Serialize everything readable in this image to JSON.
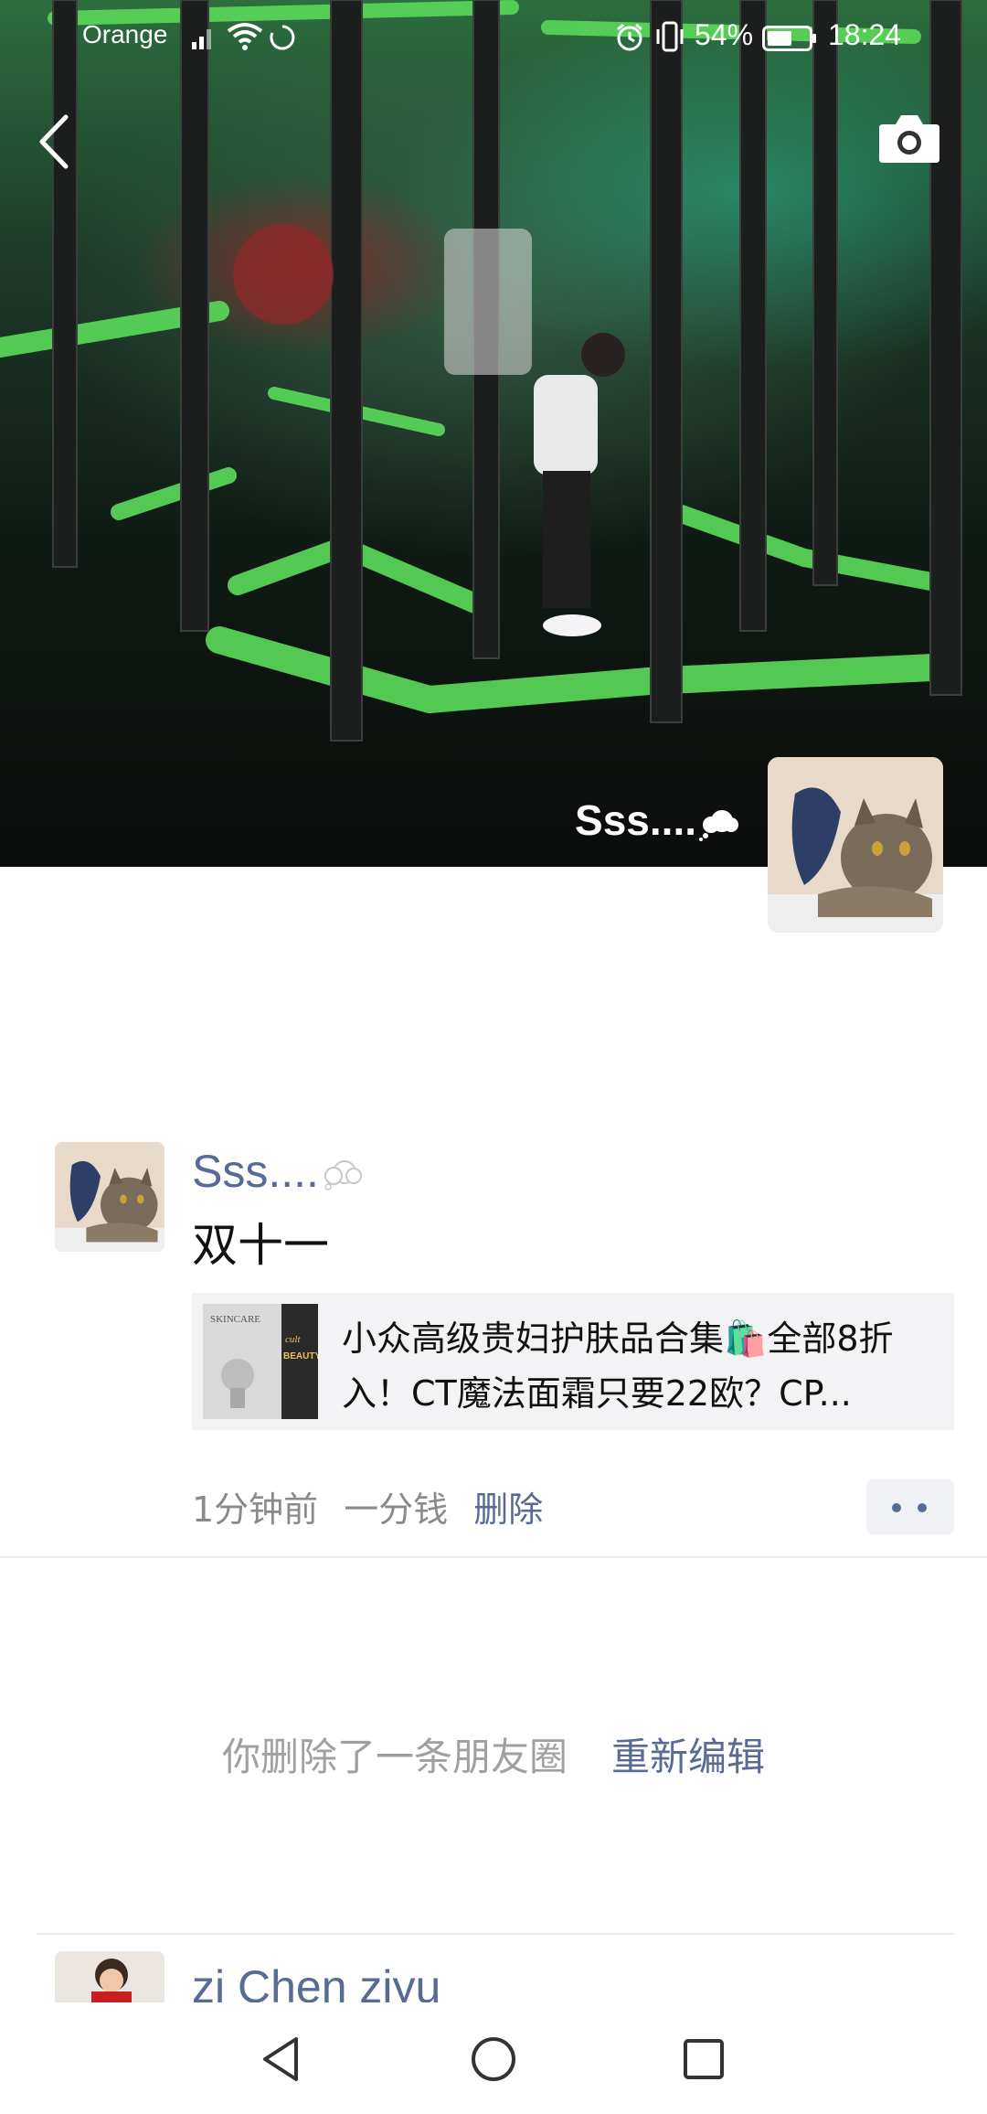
{
  "status_bar": {
    "carrier": "Orange",
    "battery_percent": "54%",
    "time": "18:24",
    "icons": [
      "signal-icon",
      "wifi-icon",
      "sync-icon",
      "alarm-icon",
      "vibrate-icon",
      "battery-icon"
    ]
  },
  "header": {
    "back_icon": "chevron-left-icon",
    "camera_icon": "camera-icon"
  },
  "cover": {
    "user_name": "Sss....",
    "name_emoji_icon": "thought-bubble-icon"
  },
  "post": {
    "author": "Sss....",
    "author_emoji_icon": "thought-bubble-icon",
    "text": "双十一",
    "link": {
      "title": "小众高级贵妇护肤品合集🛍️全部8折入！CT魔法面霜只要22欧？CP...",
      "thumb_text_1": "SKINCARE",
      "thumb_text_2": "cult",
      "thumb_text_3": "BEAUTY"
    },
    "time_ago": "1分钟前",
    "tag": "一分钱",
    "delete_label": "删除"
  },
  "deleted_notice": {
    "message": "你删除了一条朋友圈",
    "action": "重新编辑"
  },
  "next_post": {
    "author": "zi Chen ziyu"
  },
  "nav_bar": {
    "icons": [
      "nav-back-icon",
      "nav-home-icon",
      "nav-recents-icon"
    ]
  },
  "colors": {
    "link_blue": "#576b95",
    "meta_gray": "#8a8a8a",
    "card_bg": "#f3f3f5"
  }
}
